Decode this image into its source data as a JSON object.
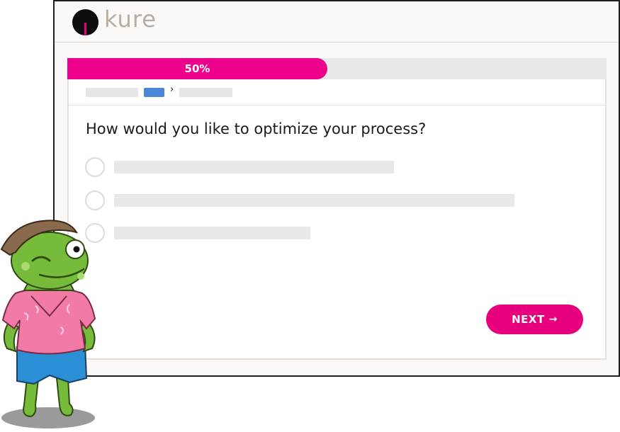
{
  "app": {
    "logo_text": "kure"
  },
  "progress": {
    "percent": 50,
    "label": "50%"
  },
  "question": {
    "text": "How would you like to optimize your process?",
    "options": [
      {
        "selected": false
      },
      {
        "selected": false
      },
      {
        "selected": false
      }
    ]
  },
  "actions": {
    "next_label": "NEXT",
    "next_icon": "arrow-right-icon",
    "next_arrow_glyph": "→"
  },
  "colors": {
    "accent": "#e6007e",
    "breadcrumb_active": "#4a86d8",
    "logo_text": "#b9aca1",
    "placeholder": "#e8e8e8"
  },
  "mascot": {
    "name": "frog-mascot-icon"
  }
}
